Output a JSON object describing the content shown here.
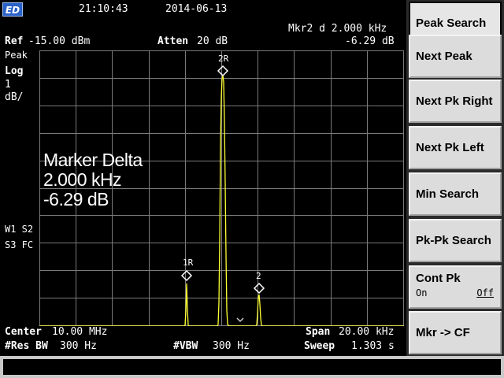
{
  "status": {
    "time": "21:10:43",
    "date": "2014-06-13",
    "logo": "ED"
  },
  "header": {
    "ref_label": "Ref",
    "ref_value": "-15.00 dBm",
    "atten_label": "Atten",
    "atten_value": "20 dB",
    "marker_readout": "Mkr2 d 2.000 kHz",
    "marker_delta_amp": "-6.29 dB"
  },
  "left_labels": {
    "detector": "Peak",
    "scale": "Log",
    "scale_value": "1",
    "scale_unit": "dB/",
    "trace_line1": "W1 S2",
    "trace_line2": "S3 FC"
  },
  "marker_delta_box": {
    "title": "Marker Delta",
    "freq": "2.000 kHz",
    "amp": "-6.29 dB"
  },
  "markers": {
    "m1": "1R",
    "m2r": "2R",
    "m2": "2"
  },
  "footer": {
    "center_label": "Center",
    "center_value": "10.00 MHz",
    "span_label": "Span",
    "span_value": "20.00 kHz",
    "rbw_label": "#Res BW",
    "rbw_value": "300 Hz",
    "vbw_label": "#VBW",
    "vbw_value": "300 Hz",
    "sweep_label": "Sweep",
    "sweep_value": "1.303 s"
  },
  "softkeys": {
    "k1": "Peak Search",
    "k2": "Next Peak",
    "k3": "Next Pk Right",
    "k4": "Next Pk Left",
    "k5": "Min Search",
    "k6": "Pk-Pk Search",
    "k7": "Cont Pk",
    "k7_on": "On",
    "k7_off": "Off",
    "k8": "Mkr -> CF"
  },
  "colors": {
    "trace": "#ffff33",
    "grid": "#7a7a7a",
    "background": "#000000",
    "logo": "#2a62c8"
  }
}
